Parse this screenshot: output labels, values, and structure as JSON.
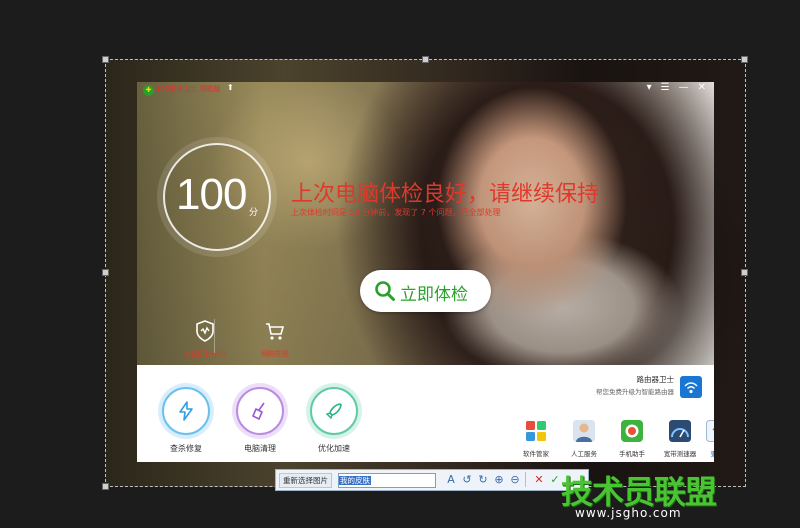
{
  "window": {
    "app_title": "360安全卫士 领航版",
    "controls": [
      "▾",
      "☰",
      "—",
      "✕"
    ]
  },
  "score": {
    "value": "100",
    "unit": "分"
  },
  "status": {
    "headline": "上次电脑体检良好，请继续保持",
    "subline": "上次体检时间是 58 分钟前，发现了 7 个问题，已全部处理"
  },
  "check_button": {
    "label": "立即体检"
  },
  "quick_links": [
    {
      "label": "安全防护中心",
      "icon": "shield-icon"
    },
    {
      "label": "网购先赔",
      "icon": "cart-icon"
    }
  ],
  "main_functions": [
    {
      "label": "查杀修复",
      "icon": "lightning-icon",
      "color": "#2f9ee6"
    },
    {
      "label": "电脑清理",
      "icon": "broom-icon",
      "color": "#9b59d6"
    },
    {
      "label": "优化加速",
      "icon": "rocket-icon",
      "color": "#27b389"
    }
  ],
  "router": {
    "title": "路由器卫士",
    "subtitle": "帮您免费升级为智能路由器"
  },
  "tools": [
    {
      "label": "软件管家",
      "icon": "software-manager-icon"
    },
    {
      "label": "人工服务",
      "icon": "customer-service-icon"
    },
    {
      "label": "手机助手",
      "icon": "phone-assistant-icon"
    },
    {
      "label": "宽带测速器",
      "icon": "speed-test-icon"
    },
    {
      "label": "更多",
      "icon": "more-icon"
    }
  ],
  "toolbar": {
    "reselect_label": "重新选择图片",
    "skin_name": "我的皮肤"
  },
  "watermark": {
    "main": "技术员联盟",
    "url": "www.jsgho.com"
  },
  "colors": {
    "accent_red": "#e0382b",
    "accent_green": "#2ba12b",
    "watermark_green": "#49c432"
  }
}
